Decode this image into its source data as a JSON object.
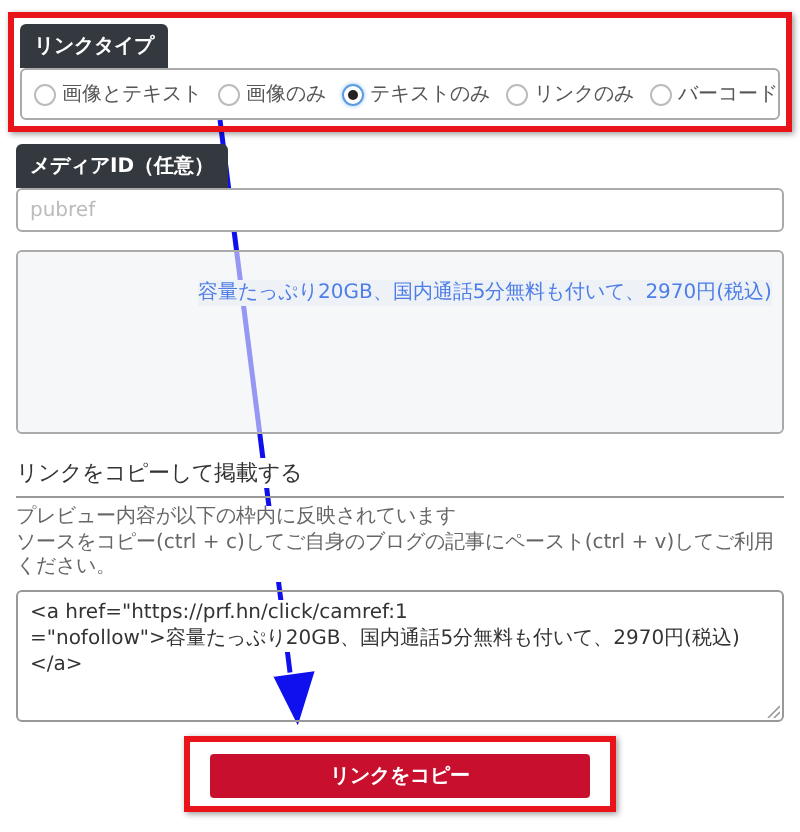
{
  "link_type": {
    "label": "リンクタイプ",
    "options": [
      {
        "label": "画像とテキスト",
        "selected": false
      },
      {
        "label": "画像のみ",
        "selected": false
      },
      {
        "label": "テキストのみ",
        "selected": true
      },
      {
        "label": "リンクのみ",
        "selected": false
      },
      {
        "label": "バーコード",
        "selected": false
      }
    ]
  },
  "media_id": {
    "label": "メディアID（任意）",
    "placeholder": "pubref"
  },
  "preview": {
    "link_text": "容量たっぷり20GB、国内通話5分無料も付いて、2970円(税込)"
  },
  "copy_section": {
    "heading": "リンクをコピーして掲載する",
    "description": [
      "プレビュー内容が以下の枠内に反映されています",
      "ソースをコピー(ctrl + c)してご自身のブログの記事にペースト(ctrl + v)してご利用ください。"
    ],
    "code_lines": [
      "<a href=\"https://prf.hn/click/camref:1",
      "=\"nofollow\">容量たっぷり20GB、国内通話5分無料も付いて、2970円(税込)",
      "</a>"
    ],
    "button": "リンクをコピー"
  }
}
